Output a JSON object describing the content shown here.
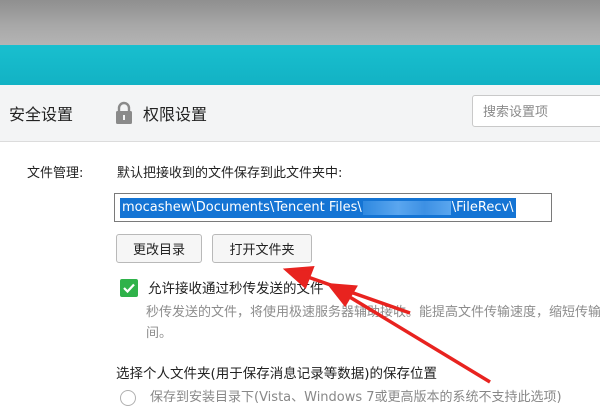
{
  "tabs": {
    "security": "安全设置",
    "permission": "权限设置"
  },
  "search": {
    "placeholder": "搜索设置项"
  },
  "file_management": {
    "label": "文件管理:",
    "description": "默认把接收到的文件保存到此文件夹中:",
    "path_prefix": "mocashew\\Documents\\Tencent Files\\",
    "path_suffix": "\\FileRecv\\",
    "change_dir_button": "更改目录",
    "open_folder_button": "打开文件夹",
    "allow_fast_transfer": {
      "label": "允许接收通过秒传发送的文件",
      "checked": true,
      "help": "秒传发送的文件，将使用极速服务器辅助接收。能提高文件传输速度，缩短传输时间。"
    }
  },
  "personal_folder": {
    "heading": "选择个人文件夹(用于保存消息记录等数据)的保存位置",
    "option_install_dir": "保存到安装目录下(Vista、Windows 7或更高版本的系统不支持此选项)"
  },
  "colors": {
    "accent_teal": "#12b2c4",
    "checkbox_green": "#2fb24a",
    "selection_blue": "#1474d4",
    "annotation_red": "#e8231f"
  },
  "icons": {
    "lock": "lock-icon",
    "check": "check-icon",
    "annotation_arrow": "red-arrow"
  }
}
